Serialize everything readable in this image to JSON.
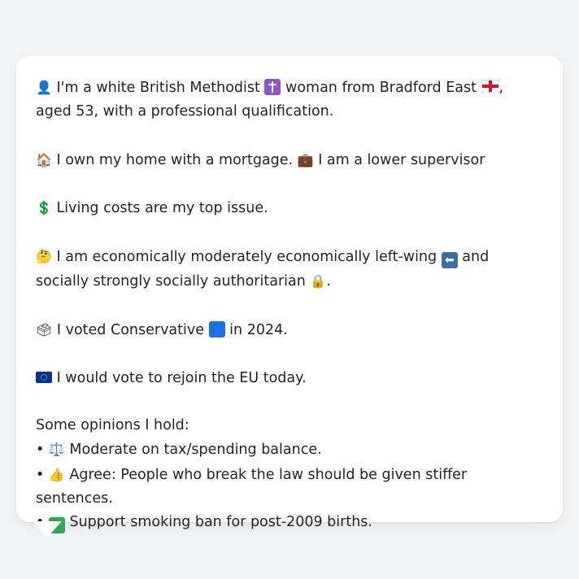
{
  "profile": {
    "line1_a": "I'm a white British Methodist",
    "line1_b": "woman from Bradford East",
    "line1_c": ", aged 53, with a professional qualification.",
    "line2_a": "I own my home with a mortgage.",
    "line2_b": "I am a lower supervisor",
    "line3": "Living costs are my top issue.",
    "line4_a": "I am economically moderately economically left-wing",
    "line4_b": "and socially strongly socially authoritarian",
    "line4_c": ".",
    "line5_a": "I voted Conservative",
    "line5_b": "in 2024.",
    "line6": "I would vote to rejoin the EU today.",
    "opinions_heading": "Some opinions I hold:",
    "opinions": [
      "Moderate on tax/spending balance.",
      "Agree: People who break the law should be given stiffer sentences.",
      "Support smoking ban for post-2009 births."
    ]
  },
  "icons": {
    "person": "person-icon",
    "cross": "latin-cross-icon",
    "flag_england": "england-flag-icon",
    "house": "house-icon",
    "briefcase": "briefcase-icon",
    "dollar": "dollar-sign-icon",
    "thinking": "thinking-face-icon",
    "left_arrow": "left-arrow-icon",
    "lock": "lock-icon",
    "ballot": "ballot-box-icon",
    "blue_square": "blue-square-icon",
    "flag_eu": "eu-flag-icon",
    "scales": "balance-scale-icon",
    "thumbs_up": "thumbs-up-icon",
    "check": "check-mark-icon"
  },
  "colors": {
    "background": "#f3f4f6",
    "card": "#ffffff",
    "text": "#1f2328",
    "conservative_blue": "#1e6fe6"
  }
}
